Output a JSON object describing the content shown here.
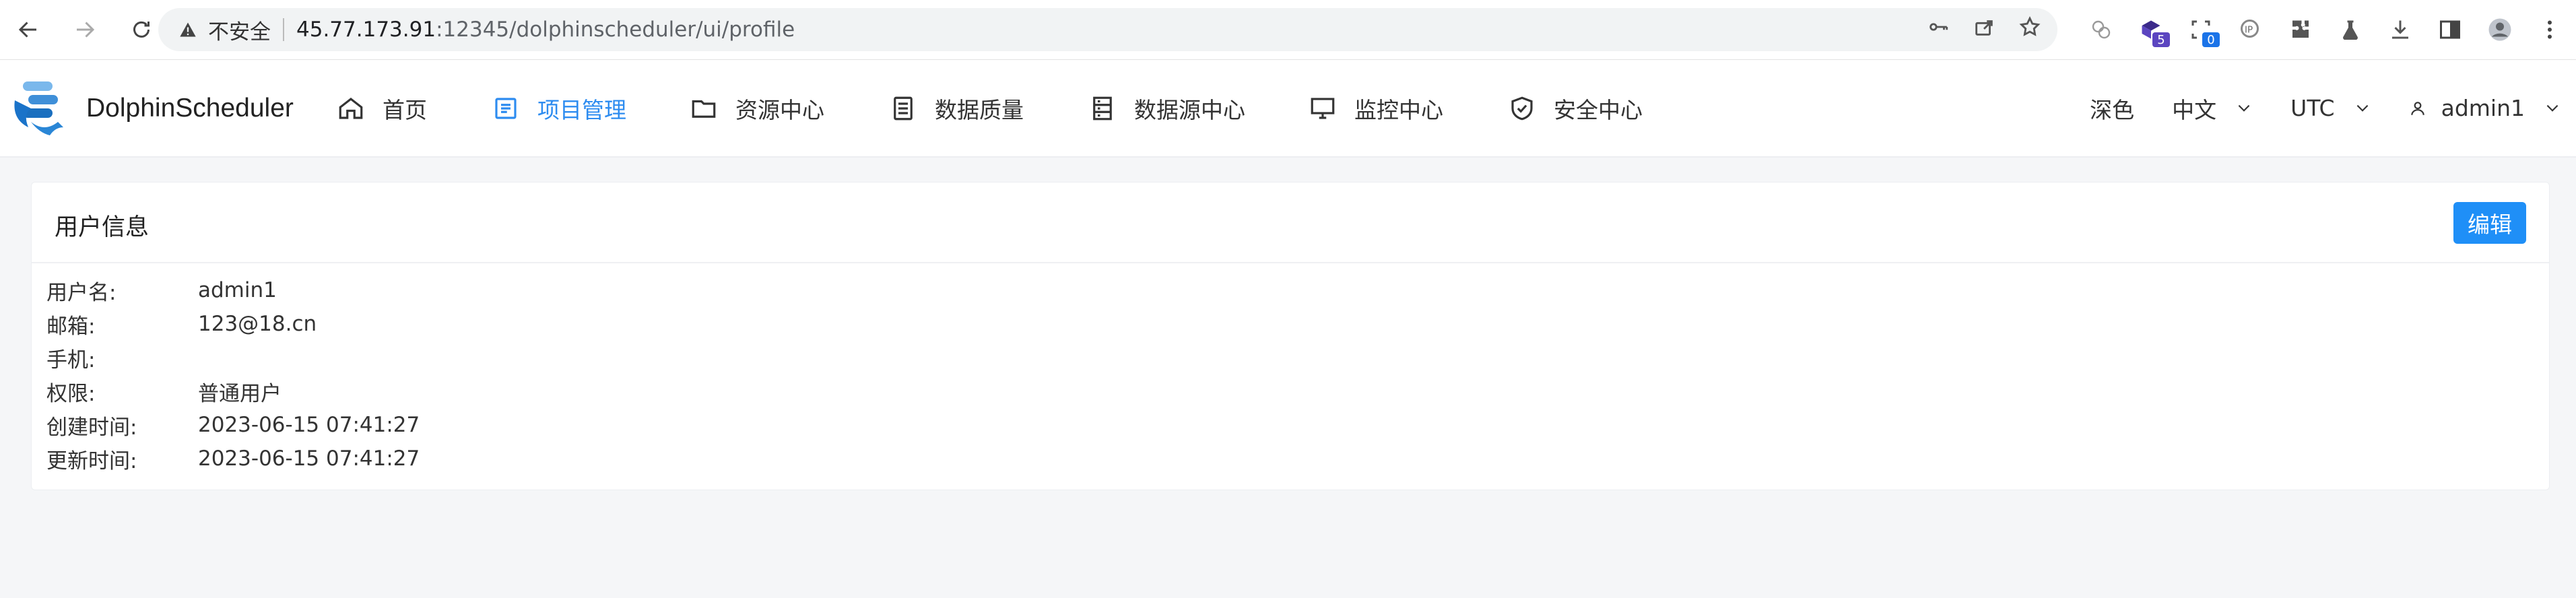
{
  "browser": {
    "security_label": "不安全",
    "url_host": "45.77.173.91",
    "url_path": ":12345/dolphinscheduler/ui/profile",
    "ext_badges": [
      "5",
      "0"
    ]
  },
  "app": {
    "brand": "DolphinScheduler",
    "menu": [
      {
        "label": "首页",
        "icon": "home-icon"
      },
      {
        "label": "项目管理",
        "icon": "project-icon"
      },
      {
        "label": "资源中心",
        "icon": "folder-icon"
      },
      {
        "label": "数据质量",
        "icon": "data-quality-icon"
      },
      {
        "label": "数据源中心",
        "icon": "datasource-icon"
      },
      {
        "label": "监控中心",
        "icon": "monitor-icon"
      },
      {
        "label": "安全中心",
        "icon": "shield-icon"
      }
    ],
    "active_menu": "项目管理",
    "theme_label": "深色",
    "language": "中文",
    "timezone": "UTC",
    "username": "admin1",
    "accent_color": "#2d8cf0"
  },
  "profile": {
    "title": "用户信息",
    "edit_label": "编辑",
    "fields": [
      {
        "label": "用户名:",
        "value": "admin1"
      },
      {
        "label": "邮箱:",
        "value": "123@18.cn"
      },
      {
        "label": "手机:",
        "value": ""
      },
      {
        "label": "权限:",
        "value": "普通用户"
      },
      {
        "label": "创建时间:",
        "value": "2023-06-15 07:41:27"
      },
      {
        "label": "更新时间:",
        "value": "2023-06-15 07:41:27"
      }
    ]
  }
}
